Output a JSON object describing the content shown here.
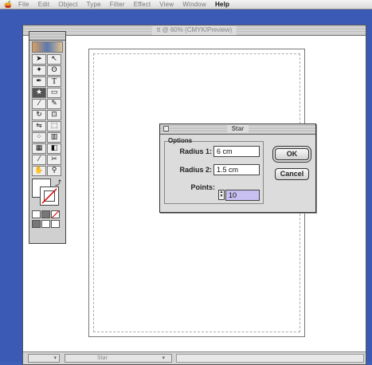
{
  "menubar": {
    "apple_icon": "apple-logo-icon",
    "items": [
      "File",
      "Edit",
      "Object",
      "Type",
      "Filter",
      "Effect",
      "View",
      "Window",
      "Help"
    ]
  },
  "document": {
    "title": "tt @ 60% (CMYK/Preview)"
  },
  "statusbar": {
    "zoom": "",
    "tool": "Star"
  },
  "dialog": {
    "title": "Star",
    "group_label": "Options",
    "radius1_label": "Radius 1:",
    "radius1_value": "6 cm",
    "radius2_label": "Radius 2:",
    "radius2_value": "1.5 cm",
    "points_label": "Points:",
    "points_value": "10",
    "ok_label": "OK",
    "cancel_label": "Cancel"
  },
  "colors": {
    "desktop": "#3a5ab5",
    "window": "#dcdcdc",
    "selection": "#c8c0f0"
  }
}
